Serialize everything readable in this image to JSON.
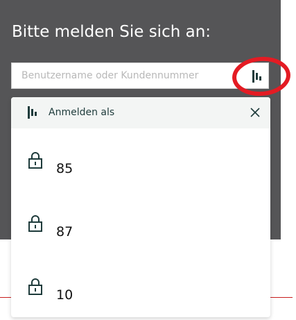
{
  "login": {
    "title": "Bitte melden Sie sich an:",
    "username_placeholder": "Benutzername oder Kundennummer"
  },
  "dropdown": {
    "header_title": "Anmelden als",
    "accounts": [
      {
        "label": "85"
      },
      {
        "label": "87"
      },
      {
        "label": "10"
      }
    ]
  },
  "colors": {
    "background_dark": "#555557",
    "icon_dark_teal": "#1e3b3b",
    "highlight_circle": "#e41b23"
  },
  "icons": {
    "key_button": "key-icon",
    "close": "close-icon",
    "account": "lock-icon"
  }
}
